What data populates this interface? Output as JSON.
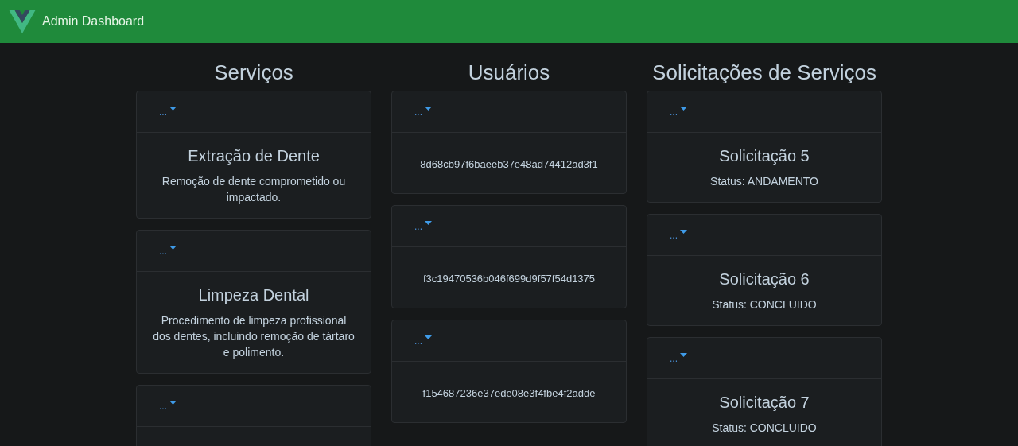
{
  "navbar": {
    "title": "Admin Dashboard"
  },
  "columns": [
    {
      "heading": "Serviços",
      "cards": [
        {
          "kind": "service",
          "menu": "...",
          "title": "Extração de Dente",
          "text": "Remoção de dente comprometido ou impactado."
        },
        {
          "kind": "service",
          "menu": "...",
          "title": "Limpeza Dental",
          "text": "Procedimento de limpeza profissional dos dentes, incluindo remoção de tártaro e polimento."
        },
        {
          "kind": "service",
          "menu": "..."
        }
      ]
    },
    {
      "heading": "Usuários",
      "cards": [
        {
          "kind": "user",
          "menu": "...",
          "text": "8d68cb97f6baeeb37e48ad74412ad3f1"
        },
        {
          "kind": "user",
          "menu": "...",
          "text": "f3c19470536b046f699d9f57f54d1375"
        },
        {
          "kind": "user",
          "menu": "...",
          "text": "f154687236e37ede08e3f4fbe4f2adde"
        }
      ]
    },
    {
      "heading": "Solicitações de Serviços",
      "cards": [
        {
          "kind": "request",
          "menu": "...",
          "title": "Solicitação 5",
          "text": "Status: ANDAMENTO"
        },
        {
          "kind": "request",
          "menu": "...",
          "title": "Solicitação 6",
          "text": "Status: CONCLUIDO"
        },
        {
          "kind": "request",
          "menu": "...",
          "title": "Solicitação 7",
          "text": "Status: CONCLUIDO"
        }
      ]
    }
  ]
}
